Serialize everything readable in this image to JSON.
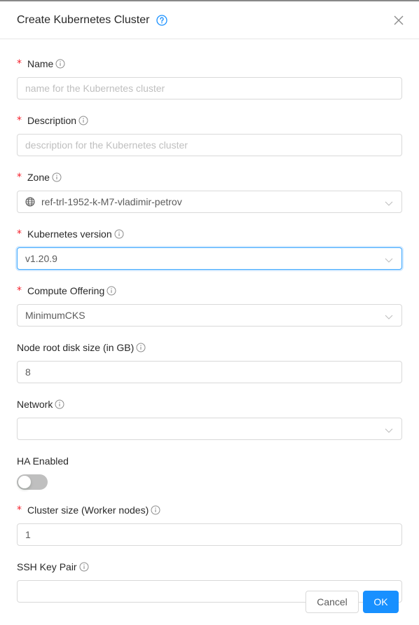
{
  "dialog": {
    "title": "Create Kubernetes Cluster",
    "accent_color": "#1890ff"
  },
  "fields": {
    "name": {
      "label": "Name",
      "required": true,
      "value": "",
      "placeholder": "name for the Kubernetes cluster"
    },
    "description": {
      "label": "Description",
      "required": true,
      "value": "",
      "placeholder": "description for the Kubernetes cluster"
    },
    "zone": {
      "label": "Zone",
      "required": true,
      "value": "ref-trl-1952-k-M7-vladimir-petrov",
      "icon": "globe-icon"
    },
    "kubernetes_version": {
      "label": "Kubernetes version",
      "required": true,
      "value": "v1.20.9"
    },
    "compute_offering": {
      "label": "Compute Offering",
      "required": true,
      "value": "MinimumCKS"
    },
    "node_root_disk_size": {
      "label": "Node root disk size (in GB)",
      "required": false,
      "value": "8"
    },
    "network": {
      "label": "Network",
      "required": false,
      "value": ""
    },
    "ha_enabled": {
      "label": "HA Enabled",
      "checked": false
    },
    "cluster_size": {
      "label": "Cluster size (Worker nodes)",
      "required": true,
      "value": "1"
    },
    "ssh_key_pair": {
      "label": "SSH Key Pair",
      "required": false,
      "value": ""
    }
  },
  "footer": {
    "cancel_label": "Cancel",
    "ok_label": "OK"
  },
  "required_marker": "*"
}
